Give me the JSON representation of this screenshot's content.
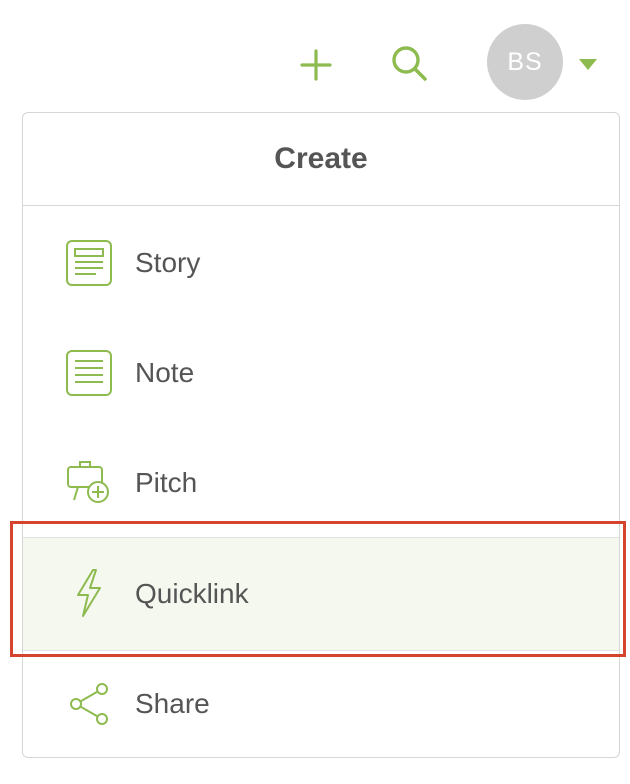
{
  "topbar": {
    "add_icon": "plus-icon",
    "search_icon": "search-icon",
    "avatar_initials": "BS",
    "dropdown_icon": "caret-down-icon"
  },
  "menu": {
    "title": "Create",
    "items": [
      {
        "label": "Story",
        "icon": "story-document-icon"
      },
      {
        "label": "Note",
        "icon": "note-icon"
      },
      {
        "label": "Pitch",
        "icon": "pitch-board-add-icon"
      },
      {
        "label": "Quicklink",
        "icon": "lightning-bolt-icon",
        "highlighted": true
      },
      {
        "label": "Share",
        "icon": "share-icon"
      }
    ]
  },
  "colors": {
    "accent_green": "#8dbb4f",
    "highlight_bg": "#f5f8ee",
    "selection_outline": "#d5452e",
    "avatar_bg": "#cfcfcf"
  }
}
